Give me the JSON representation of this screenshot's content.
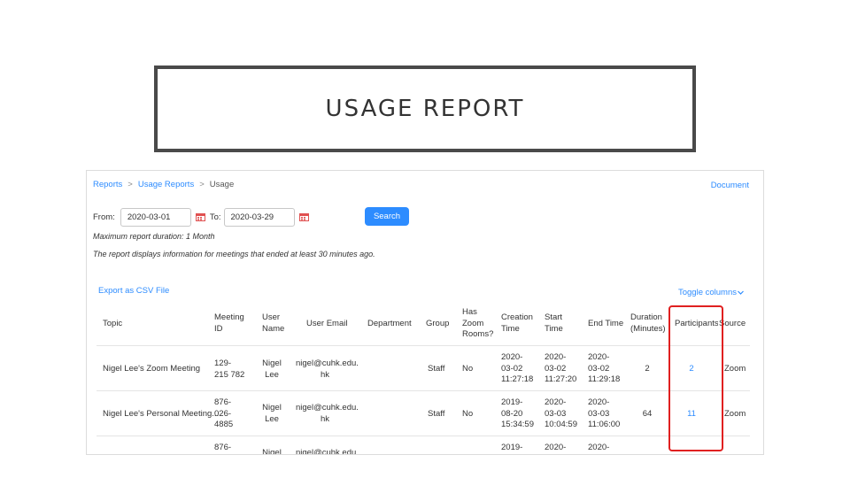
{
  "slide": {
    "title": "USAGE REPORT"
  },
  "breadcrumb": {
    "reports": "Reports",
    "sep": ">",
    "usage_reports": "Usage Reports",
    "current": "Usage"
  },
  "document_link": "Document",
  "filters": {
    "from_label": "From:",
    "from_value": "2020-03-01",
    "to_label": "To:",
    "to_value": "2020-03-29",
    "search_label": "Search"
  },
  "notes": {
    "max_duration": "Maximum report duration: 1 Month",
    "info": "The report displays information for meetings that ended at least 30 minutes ago."
  },
  "export_label": "Export as CSV File",
  "toggle_label": "Toggle columns",
  "toggle_icon": "caret-down-icon",
  "colors": {
    "link": "#2d8cff",
    "highlight": "#e02020",
    "calendar": "#e05050"
  },
  "table": {
    "headers": {
      "topic": "Topic",
      "meeting_id": [
        "Meeting",
        "ID"
      ],
      "user_name": [
        "User",
        "Name"
      ],
      "user_email": "User Email",
      "department": "Department",
      "group": "Group",
      "has_zoom_rooms": [
        "Has",
        "Zoom",
        "Rooms?"
      ],
      "creation_time": [
        "Creation",
        "Time"
      ],
      "start_time": [
        "Start",
        "Time"
      ],
      "end_time": "End Time",
      "duration": [
        "Duration",
        "(Minutes)"
      ],
      "participants": "Participants",
      "source": "Source"
    },
    "rows": [
      {
        "topic": "Nigel Lee's Zoom Meeting",
        "meeting_id": [
          "129-",
          "215 782"
        ],
        "user_name": [
          "Nigel",
          "Lee"
        ],
        "user_email": [
          "nigel@cuhk.edu.",
          "hk"
        ],
        "group": "Staff",
        "has_zoom_rooms": "No",
        "creation_time": [
          "2020-",
          "03-02",
          "11:27:18"
        ],
        "start_time": [
          "2020-",
          "03-02",
          "11:27:20"
        ],
        "end_time": [
          "2020-",
          "03-02",
          "11:29:18"
        ],
        "duration": "2",
        "participants": "2",
        "source": "Zoom"
      },
      {
        "topic": "Nigel Lee's Personal Meeting...",
        "meeting_id": [
          "876-",
          "026-",
          "4885"
        ],
        "user_name": [
          "Nigel",
          "Lee"
        ],
        "user_email": [
          "nigel@cuhk.edu.",
          "hk"
        ],
        "group": "Staff",
        "has_zoom_rooms": "No",
        "creation_time": [
          "2019-",
          "08-20",
          "15:34:59"
        ],
        "start_time": [
          "2020-",
          "03-03",
          "10:04:59"
        ],
        "end_time": [
          "2020-",
          "03-03",
          "11:06:00"
        ],
        "duration": "64",
        "participants": "11",
        "source": "Zoom"
      },
      {
        "meeting_id": [
          "876-"
        ],
        "user_name": [
          "Nigel"
        ],
        "user_email": [
          "nigel@cuhk.edu."
        ],
        "creation_time": [
          "2019-"
        ],
        "start_time": [
          "2020-"
        ],
        "end_time": [
          "2020-"
        ]
      }
    ]
  }
}
